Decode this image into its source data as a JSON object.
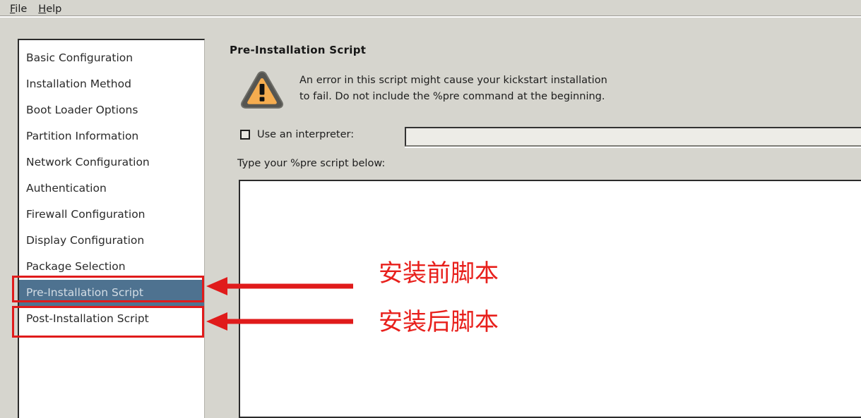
{
  "window": {
    "background_color": "#d6d5ce"
  },
  "menubar": {
    "items": [
      {
        "label": "File",
        "mnemonic": "F",
        "rest": "ile"
      },
      {
        "label": "Help",
        "mnemonic": "H",
        "rest": "elp"
      }
    ]
  },
  "sidebar": {
    "selected_index": 9,
    "selected_bg_color": "#4e7290",
    "items": [
      {
        "label": "Basic Configuration"
      },
      {
        "label": "Installation Method"
      },
      {
        "label": "Boot Loader Options"
      },
      {
        "label": "Partition Information"
      },
      {
        "label": "Network Configuration"
      },
      {
        "label": "Authentication"
      },
      {
        "label": "Firewall Configuration"
      },
      {
        "label": "Display Configuration"
      },
      {
        "label": "Package Selection"
      },
      {
        "label": "Pre-Installation Script"
      },
      {
        "label": "Post-Installation Script"
      }
    ]
  },
  "main": {
    "title": "Pre-Installation Script",
    "warning": {
      "icon": "warning-triangle-icon",
      "line1": "An error in this script might cause your kickstart installation",
      "line2": "to fail. Do not include the %pre command at the beginning."
    },
    "interpreter": {
      "checkbox_label": "Use an interpreter:",
      "checked": false,
      "value": "",
      "placeholder": ""
    },
    "script": {
      "label": "Type your %pre script below:",
      "value": "",
      "placeholder": ""
    }
  },
  "annotations": {
    "color": "#e8201c",
    "labels": [
      {
        "text": "安装前脚本"
      },
      {
        "text": "安装后脚本"
      }
    ]
  }
}
